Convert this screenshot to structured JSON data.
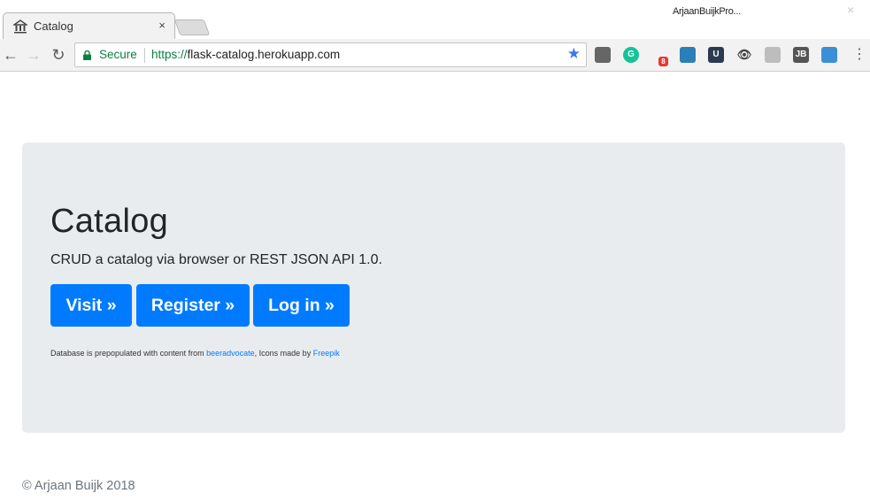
{
  "browser": {
    "tab_title": "Catalog",
    "tab_close": "×",
    "profile_name": "ArjaanBuijkPro...",
    "window_close": "×",
    "back": "←",
    "forward": "→",
    "reload": "↻",
    "secure_label": "Secure",
    "url_scheme": "https://",
    "url_rest": "flask-catalog.herokuapp.com",
    "star": "★",
    "menu": "⋮",
    "extensions": [
      {
        "name": "bookmark-manager",
        "color": "#666666",
        "label": ""
      },
      {
        "name": "grammarly",
        "color": "#15c39a",
        "label": "G"
      },
      {
        "name": "notifications",
        "color": "#ffffff",
        "label": "8"
      },
      {
        "name": "tile-extension",
        "color": "#2b7fb8",
        "label": ""
      },
      {
        "name": "ublock",
        "color": "#2a3a52",
        "label": "U"
      },
      {
        "name": "eye-extension",
        "color": "#f2f2f2",
        "label": "👁"
      },
      {
        "name": "cube-extension",
        "color": "#bdbdbd",
        "label": ""
      },
      {
        "name": "jb-extension",
        "color": "#555555",
        "label": "JB"
      },
      {
        "name": "shield-extension",
        "color": "#3b8fd6",
        "label": ""
      }
    ]
  },
  "page": {
    "heading": "Catalog",
    "lead": "CRUD a catalog via browser or REST JSON API 1.0.",
    "buttons": {
      "visit": "Visit »",
      "register": "Register »",
      "login": "Log in »"
    },
    "note": {
      "prefix": "Database is prepopulated with content from ",
      "link1": "beeradvocate",
      "middle": ", Icons made by ",
      "link2": "Freepik"
    },
    "footer": "© Arjaan Buijk 2018"
  },
  "colors": {
    "primary": "#007bff",
    "jumbotron": "#e9ecef",
    "secure_green": "#0b8043"
  }
}
